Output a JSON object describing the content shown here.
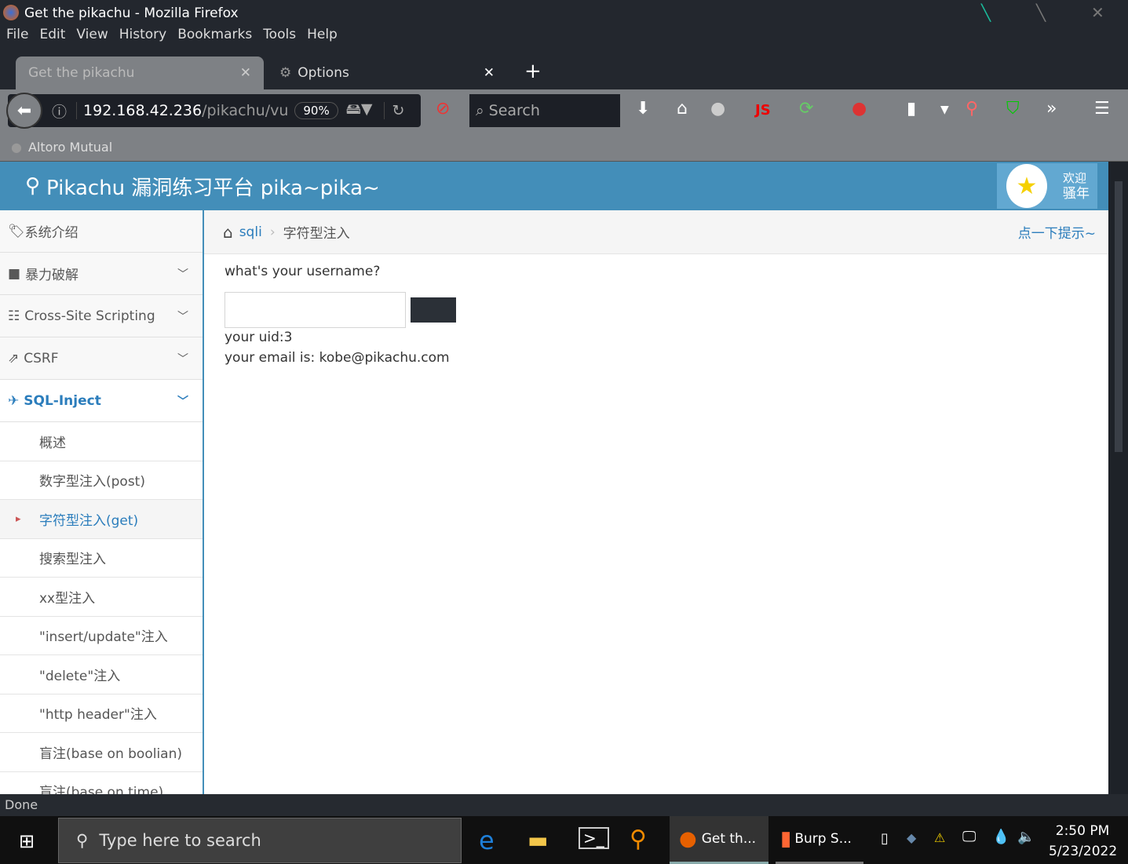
{
  "window": {
    "title": "Get the pikachu - Mozilla Firefox"
  },
  "menu": [
    "File",
    "Edit",
    "View",
    "History",
    "Bookmarks",
    "Tools",
    "Help"
  ],
  "tabs": [
    {
      "label": "Get the pikachu"
    },
    {
      "label": "Options"
    }
  ],
  "url": {
    "host": "192.168.42.236",
    "path": "/pikachu/vu",
    "zoom": "90%"
  },
  "search": {
    "placeholder": "Search"
  },
  "bookmarks": [
    {
      "label": "Altoro Mutual"
    }
  ],
  "header": {
    "title": "Pikachu 漏洞练习平台 pika~pika~",
    "welcome1": "欢迎",
    "welcome2": "骚年"
  },
  "sidebar": {
    "items": [
      {
        "label": "系统介绍"
      },
      {
        "label": "暴力破解"
      },
      {
        "label": "Cross-Site Scripting"
      },
      {
        "label": "CSRF"
      },
      {
        "label": "SQL-Inject"
      }
    ],
    "sub": [
      "概述",
      "数字型注入(post)",
      "字符型注入(get)",
      "搜索型注入",
      "xx型注入",
      "\"insert/update\"注入",
      "\"delete\"注入",
      "\"http header\"注入",
      "盲注(base on boolian)",
      "盲注(base on time)"
    ]
  },
  "breadcrumb": {
    "home": "sqli",
    "current": "字符型注入",
    "hint": "点一下提示~"
  },
  "content": {
    "question": "what's your username?",
    "input_value": "",
    "uid": "your uid:3",
    "email": "your email is: kobe@pikachu.com"
  },
  "status": "Done",
  "taskbar": {
    "search_placeholder": "Type here to search",
    "apps": [
      "Get th...",
      "Burp S..."
    ],
    "time": "2:50 PM",
    "date": "5/23/2022"
  },
  "colors": {
    "header": "#438eb9",
    "active": "#2b7dbc"
  }
}
